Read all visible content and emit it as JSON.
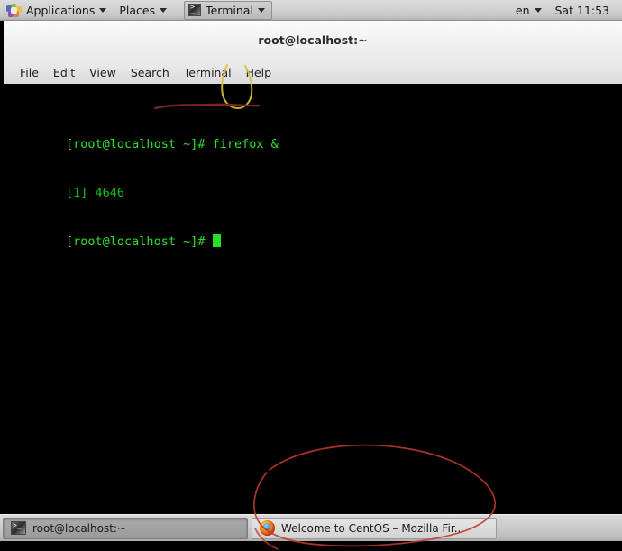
{
  "desktop": {
    "os": "CentOS GNOME Desktop",
    "background_color": "#000000"
  },
  "top_panel": {
    "background_color": "#d2d2d2",
    "applications_menu": {
      "label": "Applications",
      "icon": "centos-pinwheel-icon",
      "caret": "chevron-down-icon"
    },
    "places_menu": {
      "label": "Places",
      "caret": "chevron-down-icon"
    },
    "window_button": {
      "label": "Terminal",
      "icon": "terminal-icon",
      "caret": "chevron-down-icon"
    },
    "keyboard_indicator": {
      "label": "en",
      "caret": "chevron-down-icon"
    },
    "clock": "Sat 11:53"
  },
  "terminal_window": {
    "title": "root@localhost:~",
    "menu_items": [
      {
        "label": "File"
      },
      {
        "label": "Edit"
      },
      {
        "label": "View"
      },
      {
        "label": "Search"
      },
      {
        "label": "Terminal"
      },
      {
        "label": "Help"
      }
    ],
    "background_color": "#000000",
    "text_color": "#00cc00",
    "lines": [
      {
        "type": "command",
        "prompt": "[root@localhost ~]# ",
        "text": "firefox &"
      },
      {
        "type": "output",
        "prompt": "",
        "text": "[1] 4646"
      },
      {
        "type": "prompt",
        "prompt": "[root@localhost ~]# ",
        "text": ""
      }
    ],
    "cursor": "block-cursor"
  },
  "bottom_panel": {
    "background_color": "#cdcdcd",
    "tasks": [
      {
        "label": "root@localhost:~",
        "icon": "terminal-icon",
        "state": "active"
      },
      {
        "label": "Welcome to CentOS – Mozilla Fir...",
        "icon": "firefox-icon",
        "state": "inactive"
      }
    ]
  },
  "annotations": [
    {
      "name": "yellow-circle-ampersand",
      "shape": "ellipse",
      "color": "#d8c03a",
      "target": "ampersand in firefox & command"
    },
    {
      "name": "red-underline-command",
      "shape": "line",
      "color": "#7a2424",
      "target": "firefox & command line"
    },
    {
      "name": "red-circle-taskbar-firefox",
      "shape": "ellipse",
      "color": "#c0392b",
      "target": "Welcome to CentOS - Mozilla Firefox taskbar button"
    }
  ]
}
